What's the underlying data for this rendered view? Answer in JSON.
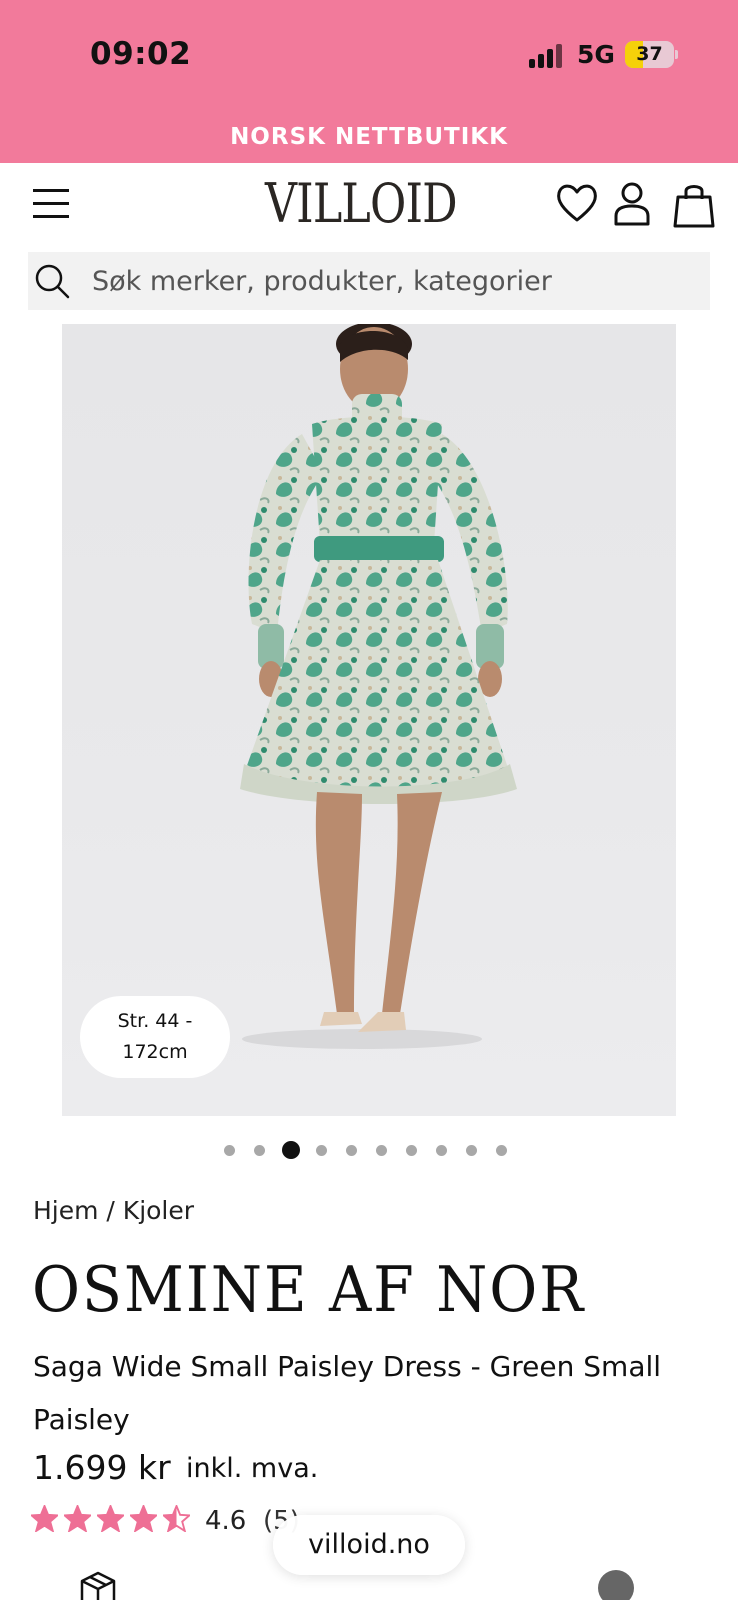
{
  "status_bar": {
    "time": "09:02",
    "network": "5G",
    "battery": "37",
    "battery_level": 0.37
  },
  "banner": {
    "text": "NORSK NETTBUTIKK"
  },
  "header": {
    "logo": "VILLOID",
    "icons": [
      "menu-icon",
      "heart-icon",
      "user-icon",
      "bag-icon"
    ]
  },
  "search": {
    "placeholder": "Søk merker, produkter, kategorier"
  },
  "gallery": {
    "size_badge_line1": "Str. 44 -",
    "size_badge_line2": "172cm",
    "image_count": 10,
    "active_index": 2
  },
  "product": {
    "breadcrumb": "Hjem / Kjoler",
    "brand": "OSMINE AF NOR",
    "name": "Saga Wide Small Paisley Dress - Green Small Paisley",
    "price": "1.699 kr",
    "vat_note": "inkl. mva.",
    "rating": "4.6",
    "rating_value": 4.6,
    "review_count": "(5)"
  },
  "browser": {
    "url": "villoid.no"
  },
  "colors": {
    "accent_pink": "#f27a9b",
    "star_pink": "#ee6f95",
    "search_bg": "#f2f2f2"
  }
}
